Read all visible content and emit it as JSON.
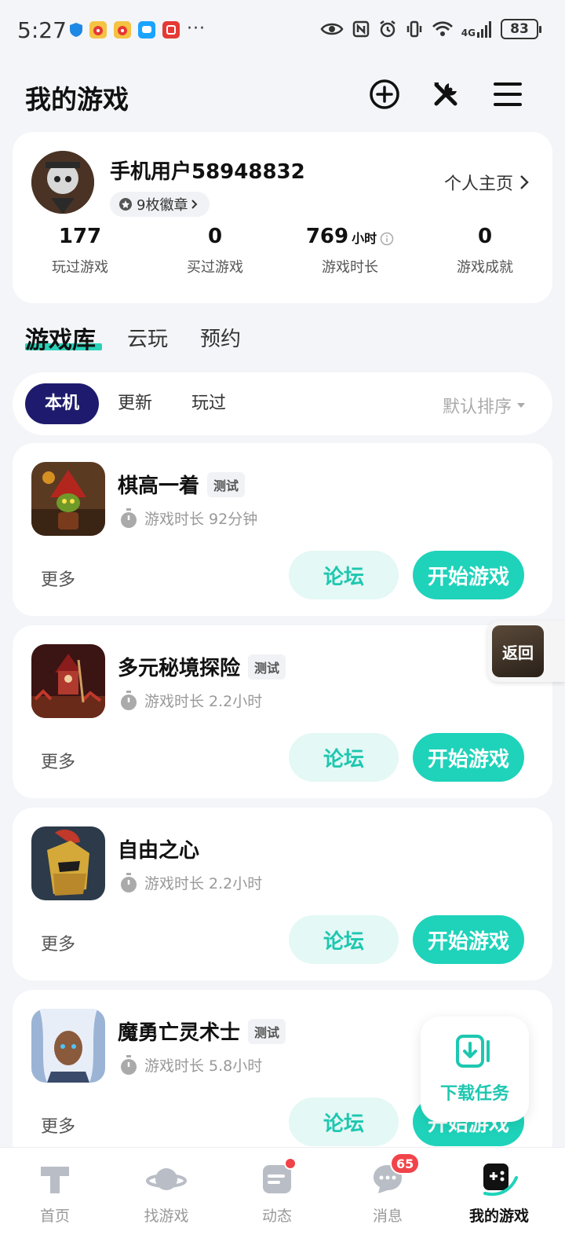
{
  "status_bar": {
    "time": "5:27",
    "more": "···",
    "network": "4G",
    "battery": "83"
  },
  "header": {
    "title": "我的游戏",
    "icons": [
      "add-circle-icon",
      "tools-icon",
      "menu-icon"
    ]
  },
  "profile": {
    "username": "手机用户58948832",
    "badges": "9枚徽章",
    "homepage": "个人主页",
    "stats": [
      {
        "value": "177",
        "unit": "",
        "label": "玩过游戏"
      },
      {
        "value": "0",
        "unit": "",
        "label": "买过游戏"
      },
      {
        "value": "769",
        "unit": "小时",
        "label": "游戏时长"
      },
      {
        "value": "0",
        "unit": "",
        "label": "游戏成就"
      }
    ]
  },
  "tabs": [
    {
      "label": "游戏库",
      "active": true
    },
    {
      "label": "云玩",
      "active": false
    },
    {
      "label": "预约",
      "active": false
    }
  ],
  "filters": {
    "chips": [
      "本机",
      "更新",
      "玩过"
    ],
    "selected": "本机",
    "sort": "默认排序"
  },
  "games": [
    {
      "name": "棋高一着",
      "tag": "测试",
      "playtime": "游戏时长 92分钟",
      "more": "更多",
      "forum": "论坛",
      "play": "开始游戏"
    },
    {
      "name": "多元秘境探险",
      "tag": "测试",
      "playtime": "游戏时长 2.2小时",
      "more": "更多",
      "forum": "论坛",
      "play": "开始游戏"
    },
    {
      "name": "自由之心",
      "tag": "",
      "playtime": "游戏时长 2.2小时",
      "more": "更多",
      "forum": "论坛",
      "play": "开始游戏"
    },
    {
      "name": "魔勇亡灵术士",
      "tag": "测试",
      "playtime": "游戏时长 5.8小时",
      "more": "更多",
      "forum": "论坛",
      "play": "开始游戏"
    }
  ],
  "floating": {
    "back": "返回",
    "download": "下载任务"
  },
  "bottom_nav": {
    "items": [
      {
        "label": "首页",
        "icon": "home-t-icon"
      },
      {
        "label": "找游戏",
        "icon": "planet-icon"
      },
      {
        "label": "动态",
        "icon": "feed-icon"
      },
      {
        "label": "消息",
        "icon": "chat-icon"
      },
      {
        "label": "我的游戏",
        "icon": "gamepad-icon"
      }
    ],
    "message_count": "65"
  },
  "colors": {
    "accent": "#1ed3ba",
    "chip_active": "#1e1b6e",
    "badge_red": "#f0444a"
  }
}
